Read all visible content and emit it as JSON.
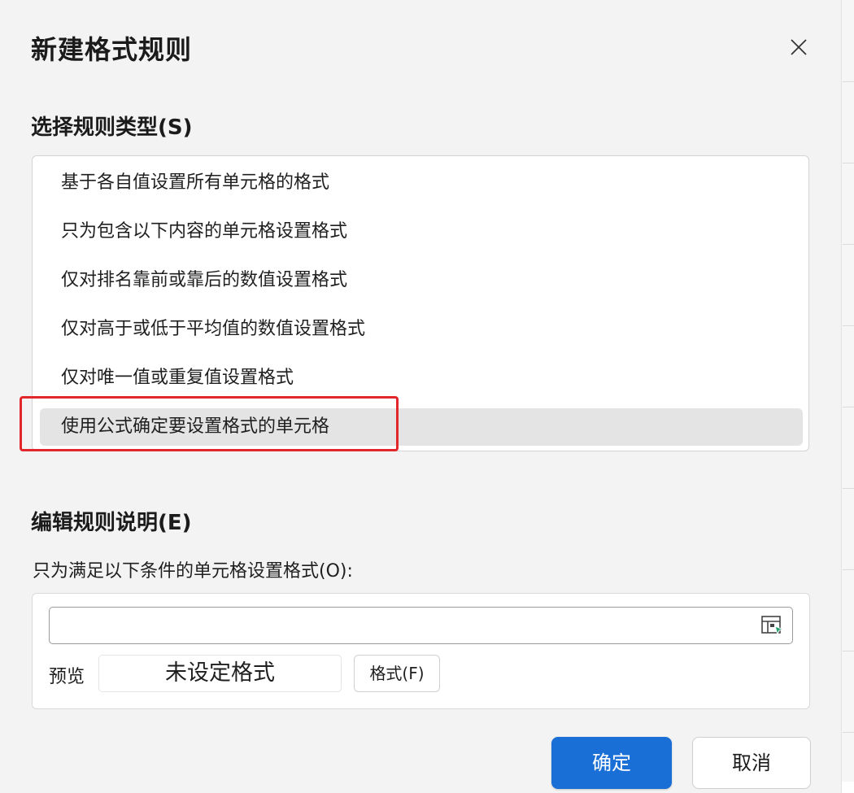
{
  "dialog": {
    "title": "新建格式规则",
    "close_icon": "close-icon"
  },
  "rule_type": {
    "label": "选择规则类型(S)",
    "items": [
      {
        "label": "基于各自值设置所有单元格的格式",
        "selected": false
      },
      {
        "label": "只为包含以下内容的单元格设置格式",
        "selected": false
      },
      {
        "label": "仅对排名靠前或靠后的数值设置格式",
        "selected": false
      },
      {
        "label": "仅对高于或低于平均值的数值设置格式",
        "selected": false
      },
      {
        "label": "仅对唯一值或重复值设置格式",
        "selected": false
      },
      {
        "label": "使用公式确定要设置格式的单元格",
        "selected": true
      }
    ]
  },
  "edit_rule": {
    "label": "编辑规则说明(E)",
    "condition_label": "只为满足以下条件的单元格设置格式(O):",
    "formula_value": "",
    "range_picker_icon": "range-select-icon",
    "preview_label": "预览",
    "preview_text": "未设定格式",
    "format_button": "格式(F)"
  },
  "footer": {
    "ok_button": "确定",
    "cancel_button": "取消"
  },
  "colors": {
    "primary": "#1a6fd6",
    "highlight": "#e3262b",
    "selected_bg": "#e4e4e4",
    "dialog_bg": "#f3f3f3"
  }
}
